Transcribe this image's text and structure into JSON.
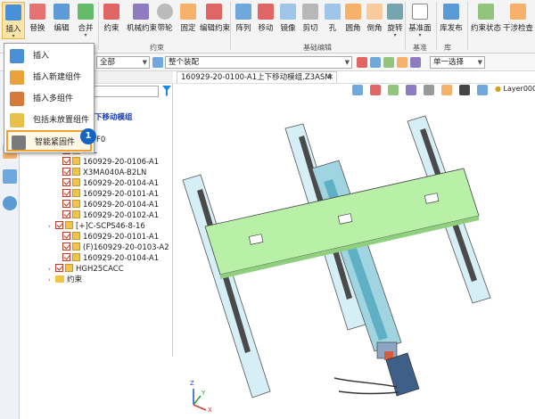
{
  "ribbon": {
    "buttons": [
      {
        "label": "插入",
        "icon": "insert-icon"
      },
      {
        "label": "替换",
        "icon": "replace-icon"
      },
      {
        "label": "编辑",
        "icon": "edit-icon"
      },
      {
        "label": "合并",
        "icon": "merge-icon"
      },
      {
        "label": "约束",
        "icon": "constraint-icon"
      },
      {
        "label": "机械约束",
        "icon": "mechanical-constraint-icon"
      },
      {
        "label": "带轮",
        "icon": "pulley-icon"
      },
      {
        "label": "固定",
        "icon": "fix-icon"
      },
      {
        "label": "编辑约束",
        "icon": "edit-constraint-icon"
      },
      {
        "label": "阵列",
        "icon": "pattern-icon"
      },
      {
        "label": "移动",
        "icon": "move-icon"
      },
      {
        "label": "镜像",
        "icon": "mirror-icon"
      },
      {
        "label": "剪切",
        "icon": "cut-icon"
      },
      {
        "label": "孔",
        "icon": "hole-icon"
      },
      {
        "label": "圆角",
        "icon": "fillet-icon"
      },
      {
        "label": "倒角",
        "icon": "chamfer-icon"
      },
      {
        "label": "旋转",
        "icon": "rotate-icon"
      },
      {
        "label": "基准面",
        "icon": "datum-plane-icon"
      },
      {
        "label": "库发布",
        "icon": "library-publish-icon"
      },
      {
        "label": "约束状态",
        "icon": "constraint-status-icon"
      },
      {
        "label": "干涉检查",
        "icon": "interference-check-icon"
      }
    ],
    "groups": [
      "约束",
      "基础编辑",
      "基准",
      "库"
    ]
  },
  "toolbar2": {
    "filter_value": "全部",
    "scope_value": "整个装配",
    "select_mode": "单一选择",
    "layer_value": "Layer0000"
  },
  "document_tab": {
    "title": "160929-20-0100-A1上下移动模组.Z3ASM"
  },
  "tree": {
    "rows": [
      {
        "label": "下移动模组",
        "type": "title"
      },
      {
        "label": "F0",
        "type": "text"
      },
      {
        "label": "80L",
        "type": "text"
      },
      {
        "label": "160929-20-0106-A1",
        "type": "part"
      },
      {
        "label": "X3MA040A-B2LN",
        "type": "part"
      },
      {
        "label": "160929-20-0104-A1",
        "type": "part"
      },
      {
        "label": "160929-20-0101-A1",
        "type": "part"
      },
      {
        "label": "160929-20-0104-A1",
        "type": "part"
      },
      {
        "label": "160929-20-0102-A1",
        "type": "part"
      },
      {
        "label": "[+]C-SCPS46-8-16",
        "type": "part"
      },
      {
        "label": "160929-20-0101-A1",
        "type": "part"
      },
      {
        "label": "(F)160929-20-0103-A2",
        "type": "part"
      },
      {
        "label": "160929-20-0104-A1",
        "type": "part"
      },
      {
        "label": "HGH25CACC",
        "type": "part"
      },
      {
        "label": "约束",
        "type": "folder"
      }
    ]
  },
  "insert_menu": {
    "items": [
      {
        "label": "插入",
        "icon": "insert-component-icon"
      },
      {
        "label": "插入新建组件",
        "icon": "insert-new-component-icon"
      },
      {
        "label": "插入多组件",
        "icon": "insert-multiple-components-icon"
      },
      {
        "label": "包括未放置组件",
        "icon": "include-unplaced-components-icon"
      },
      {
        "label": "智能紧固件",
        "icon": "smart-fastener-icon"
      }
    ],
    "badge": "1"
  },
  "axes": {
    "x": "X",
    "y": "Y",
    "z": "Z"
  }
}
